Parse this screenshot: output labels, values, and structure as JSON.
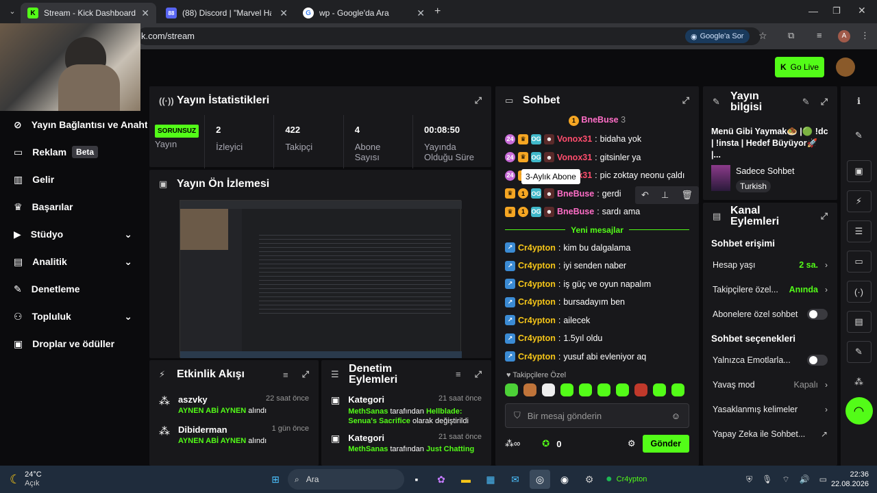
{
  "browser": {
    "tabs": [
      {
        "title": "Stream - Kick Dashboard",
        "icon": "kick-icon"
      },
      {
        "title": "(88) Discord | \"Marvel Haki...",
        "icon": "discord-icon"
      },
      {
        "title": "wp - Google'da Ara",
        "icon": "google-icon"
      }
    ],
    "url": "k.com/stream",
    "google_sor": "Google'a Sor",
    "profile_initial": "A"
  },
  "topbar": {
    "go_live": "Go Live"
  },
  "sidebar": {
    "items": [
      {
        "label": "Yayın Bağlantısı ve Anahta",
        "icon": "link-icon"
      },
      {
        "label": "Reklam",
        "badge": "Beta",
        "icon": "ad-icon"
      },
      {
        "label": "Gelir",
        "icon": "revenue-icon"
      },
      {
        "label": "Başarılar",
        "icon": "trophy-icon"
      },
      {
        "label": "Stüdyo",
        "icon": "studio-icon",
        "expandable": true
      },
      {
        "label": "Analitik",
        "icon": "analytics-icon",
        "expandable": true
      },
      {
        "label": "Denetleme",
        "icon": "wrench-icon"
      },
      {
        "label": "Topluluk",
        "icon": "community-icon",
        "expandable": true
      },
      {
        "label": "Droplar ve ödüller",
        "icon": "drops-icon"
      }
    ]
  },
  "stats": {
    "title": "Yayın İstatistikleri",
    "status_badge": "SORUNSUZ",
    "status_label": "Yayın",
    "items": [
      {
        "value": "2",
        "label": "İzleyici"
      },
      {
        "value": "422",
        "label": "Takipçi"
      },
      {
        "value": "4",
        "label": "Abone Sayısı"
      },
      {
        "value": "00:08:50",
        "label": "Yayında Olduğu Süre"
      }
    ]
  },
  "preview": {
    "title": "Yayın Ön İzlemesi"
  },
  "activity": {
    "title": "Etkinlik Akışı",
    "items": [
      {
        "user": "aszvky",
        "time": "22 saat önce",
        "reward": "AYNEN ABİ AYNEN",
        "action": "alındı"
      },
      {
        "user": "Dibiderman",
        "time": "1 gün önce",
        "reward": "AYNEN ABİ AYNEN",
        "action": "alındı"
      }
    ]
  },
  "moderation": {
    "title": "Denetim Eylemleri",
    "items": [
      {
        "type": "Kategori",
        "time": "21 saat önce",
        "user": "MethSanas",
        "mid": "tarafından",
        "target": "Hellblade: Senua's Sacrifice",
        "tail": "olarak değiştirildi"
      },
      {
        "type": "Kategori",
        "time": "21 saat önce",
        "user": "MethSanas",
        "mid": "tarafından",
        "target": "Just Chatting",
        "tail": ""
      }
    ]
  },
  "chat": {
    "title": "Sohbet",
    "pinned_user": "BneBuse",
    "pinned_count": "3",
    "tooltip": "3-Aylık Abone",
    "new_messages": "Yeni mesajlar",
    "messages": [
      {
        "user": "Vonox31",
        "text": "bidaha yok",
        "color": "#ff4d6d"
      },
      {
        "user": "Vonox31",
        "text": "gitsinler ya",
        "color": "#ff4d6d"
      },
      {
        "user": "Vonox31",
        "text": "pic zoktay neonu çaldı",
        "color": "#ff4d6d"
      },
      {
        "user": "BneBuse",
        "text": "gerdi",
        "color": "#ff6ec7"
      },
      {
        "user": "BneBuse",
        "text": "sardı ama",
        "color": "#ff6ec7"
      },
      {
        "user": "Cr4ypton",
        "text": "kim bu dalgalama",
        "color": "#f5c518"
      },
      {
        "user": "Cr4ypton",
        "text": "iyi senden naber",
        "color": "#f5c518"
      },
      {
        "user": "Cr4ypton",
        "text": "iş güç ve oyun napalım",
        "color": "#f5c518"
      },
      {
        "user": "Cr4ypton",
        "text": "bursadayım ben",
        "color": "#f5c518"
      },
      {
        "user": "Cr4ypton",
        "text": "ailecek",
        "color": "#f5c518"
      },
      {
        "user": "Cr4ypton",
        "text": "1.5yıl oldu",
        "color": "#f5c518"
      },
      {
        "user": "Cr4ypton",
        "text": "yusuf abi evleniyor aq",
        "color": "#f5c518"
      }
    ],
    "followers_only": "Takipçilere Özel",
    "input_placeholder": "Bir mesaj gönderin",
    "points": "0",
    "send": "Gönder"
  },
  "stream_info": {
    "title": "Yayın bilgisi",
    "stream_title": "Menü Gibi Yaymak🧆 |🟢 !dc | !insta | Hedef Büyüyor🚀 |...",
    "category": "Sadece Sohbet",
    "language": "Turkish"
  },
  "channel": {
    "title": "Kanal Eylemleri",
    "chat_access": "Sohbet erişimi",
    "account_age_label": "Hesap yaşı",
    "account_age_value": "2 sa.",
    "followers_label": "Takipçilere özel...",
    "followers_value": "Anında",
    "subs_label": "Abonelere özel sohbet",
    "chat_options": "Sohbet seçenekleri",
    "emote_label": "Yalnızca Emotlarla...",
    "slow_label": "Yavaş mod",
    "slow_value": "Kapalı",
    "banned_label": "Yasaklanmış kelimeler",
    "ai_label": "Yapay Zeka ile Sohbet..."
  },
  "taskbar": {
    "weather_temp": "24°C",
    "weather_desc": "Açık",
    "search": "Ara",
    "spotify_user": "Cr4ypton",
    "time": "22:36",
    "date": "22.08.2026"
  },
  "colors": {
    "accent": "#53fc18"
  }
}
